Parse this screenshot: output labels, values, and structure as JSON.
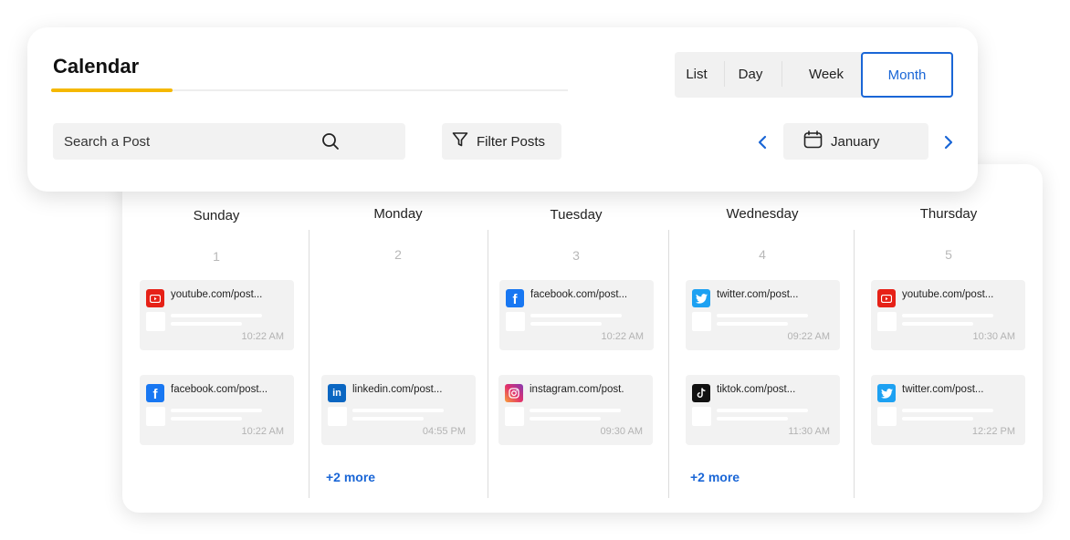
{
  "header": {
    "title": "Calendar",
    "views": [
      "List",
      "Day",
      "Week",
      "Month"
    ],
    "active_view": "Month",
    "search_placeholder": "Search a Post",
    "filter_label": "Filter Posts",
    "month": "January"
  },
  "colors": {
    "accent": "#1a66d6",
    "title_underline": "#f5b800",
    "youtube": "#e62117",
    "facebook": "#1877f2",
    "twitter": "#1da1f2",
    "linkedin": "#0a66c2",
    "tiktok": "#111111"
  },
  "days": [
    {
      "name": "Sunday",
      "date": "1",
      "posts": [
        {
          "platform": "youtube",
          "url": "youtube.com/post...",
          "time": "10:22 AM"
        },
        {
          "platform": "facebook",
          "url": "facebook.com/post...",
          "time": "10:22 AM"
        }
      ],
      "more": ""
    },
    {
      "name": "Monday",
      "date": "2",
      "posts": [
        {
          "platform": "linkedin",
          "url": "linkedin.com/post...",
          "time": "04:55 PM"
        }
      ],
      "more": "+2 more"
    },
    {
      "name": "Tuesday",
      "date": "3",
      "posts": [
        {
          "platform": "facebook",
          "url": "facebook.com/post...",
          "time": "10:22 AM"
        },
        {
          "platform": "instagram",
          "url": "instagram.com/post.",
          "time": "09:30 AM"
        }
      ],
      "more": ""
    },
    {
      "name": "Wednesday",
      "date": "4",
      "posts": [
        {
          "platform": "twitter",
          "url": "twitter.com/post...",
          "time": "09:22 AM"
        },
        {
          "platform": "tiktok",
          "url": "tiktok.com/post...",
          "time": "11:30 AM"
        }
      ],
      "more": "+2 more"
    },
    {
      "name": "Thursday",
      "date": "5",
      "posts": [
        {
          "platform": "youtube",
          "url": "youtube.com/post...",
          "time": "10:30 AM"
        },
        {
          "platform": "twitter",
          "url": "twitter.com/post...",
          "time": "12:22 PM"
        }
      ],
      "more": ""
    }
  ]
}
